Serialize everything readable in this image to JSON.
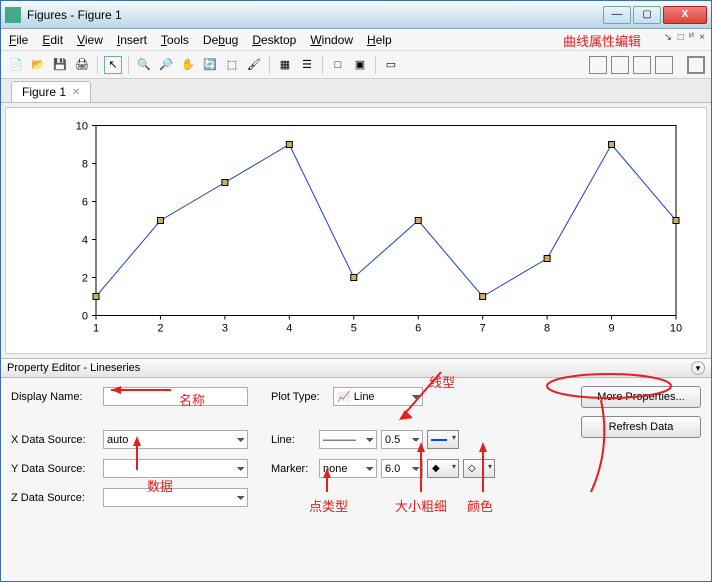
{
  "window": {
    "title": "Figures - Figure 1"
  },
  "menubar": {
    "items": [
      "File",
      "Edit",
      "View",
      "Insert",
      "Tools",
      "Debug",
      "Desktop",
      "Window",
      "Help"
    ]
  },
  "annotations": {
    "top_right": "曲线属性编辑",
    "name": "名称",
    "data": "数据",
    "linestyle": "线型",
    "markertype": "点类型",
    "sizewidth": "大小粗细",
    "color": "颜色"
  },
  "tab": {
    "label": "Figure 1"
  },
  "chart_data": {
    "type": "line",
    "x": [
      1,
      2,
      3,
      4,
      5,
      6,
      7,
      8,
      9,
      10
    ],
    "y": [
      1,
      5,
      7,
      9,
      2,
      5,
      1,
      3,
      9,
      5
    ],
    "xlim": [
      1,
      10
    ],
    "ylim": [
      0,
      10
    ],
    "xticks": [
      1,
      2,
      3,
      4,
      5,
      6,
      7,
      8,
      9,
      10
    ],
    "yticks": [
      0,
      2,
      4,
      6,
      8,
      10
    ],
    "line_color": "#1f3fbf",
    "marker": "square",
    "marker_edge": "#000000",
    "marker_fill": "#c8b060"
  },
  "prop_editor": {
    "title": "Property Editor - Lineseries",
    "display_name_label": "Display Name:",
    "display_name_value": "",
    "x_src_label": "X Data Source:",
    "x_src_value": "auto",
    "y_src_label": "Y Data Source:",
    "y_src_value": "",
    "z_src_label": "Z Data Source:",
    "z_src_value": "",
    "plot_type_label": "Plot Type:",
    "plot_type_value": "Line",
    "line_label": "Line:",
    "line_style": "———",
    "line_width": "0.5",
    "marker_label": "Marker:",
    "marker_value": "none",
    "marker_size": "6.0",
    "more_props": "More Properties...",
    "refresh": "Refresh Data"
  }
}
